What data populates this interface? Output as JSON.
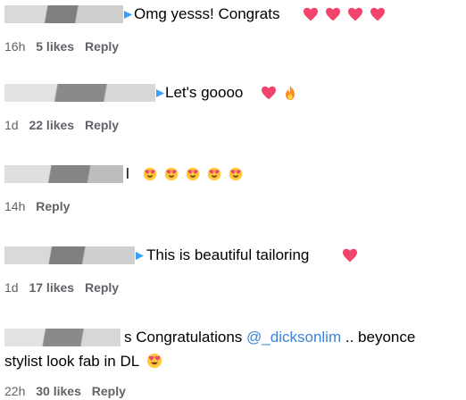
{
  "comments": [
    {
      "text": "Omg yesss! Congrats",
      "time": "16h",
      "likes": "5 likes",
      "reply": "Reply",
      "emojis": [
        "heart-emoji",
        "heart-emoji",
        "heart-emoji",
        "heart-emoji"
      ]
    },
    {
      "text": "Let's goooo",
      "time": "1d",
      "likes": "22 likes",
      "reply": "Reply",
      "emojis": [
        "heart-emoji",
        "fire-emoji"
      ]
    },
    {
      "text": "l",
      "time": "14h",
      "likes": "",
      "reply": "Reply",
      "emojis": [
        "heart-eyes-emoji",
        "heart-eyes-emoji",
        "heart-eyes-emoji",
        "heart-eyes-emoji",
        "heart-eyes-emoji"
      ]
    },
    {
      "text": "This is beautiful tailoring",
      "time": "1d",
      "likes": "17 likes",
      "reply": "Reply",
      "emojis": [
        "heart-emoji"
      ]
    },
    {
      "text_before": "s Congratulations",
      "mention": "@_dicksonlim",
      "text_after": ".. beyonce",
      "text_line2": "stylist look fab in DL",
      "time": "22h",
      "likes": "30 likes",
      "reply": "Reply",
      "emojis": [
        "heart-eyes-emoji"
      ]
    }
  ],
  "colors": {
    "heart": "#f2436b",
    "fire": "#ff8a1f",
    "mention": "#3d82d9",
    "meta": "#5f6368"
  }
}
